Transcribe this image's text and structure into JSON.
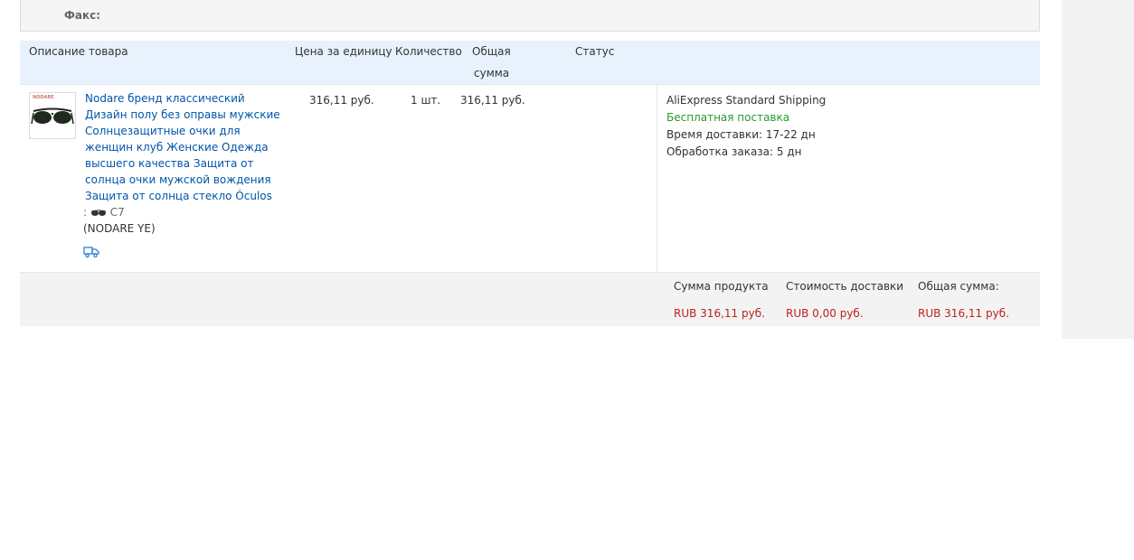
{
  "contact": {
    "fax_label": "Факс:"
  },
  "table": {
    "headers": {
      "description": "Описание товара",
      "unit_price": "Цена за единицу",
      "quantity": "Количество",
      "total_line1": "Общая",
      "total_line2": "сумма",
      "status": "Статус"
    },
    "item": {
      "thumb_brand": "NODARE",
      "title": "Nodare бренд классический Дизайн полу без оправы мужские Солнцезащитные очки для женщин клуб Женские Одежда высшего качества Защита от солнца очки мужской вождения Защита от солнца стекло Óculos",
      "prop_prefix": ":",
      "prop_value": "C7",
      "brand": "(NODARE YE)",
      "unit_price": "316,11 руб.",
      "quantity": "1 шт.",
      "total": "316,11 руб.",
      "shipping": {
        "method": "AliExpress Standard Shipping",
        "free": "Бесплатная поставка",
        "delivery_time": "Время доставки: 17-22 дн",
        "processing": "Обработка заказа: 5 дн"
      }
    },
    "footer": {
      "product_sum_label": "Сумма продукта",
      "shipping_cost_label": "Стоимость доставки",
      "grand_total_label": "Общая сумма:",
      "product_sum": "RUB 316,11 руб.",
      "shipping_cost": "RUB 0,00 руб.",
      "grand_total": "RUB 316,11 руб."
    }
  },
  "colors": {
    "link": "#0055aa",
    "free_shipping": "#2a9a2a",
    "price_red": "#bb2222",
    "header_bg": "#e8f2fd"
  }
}
